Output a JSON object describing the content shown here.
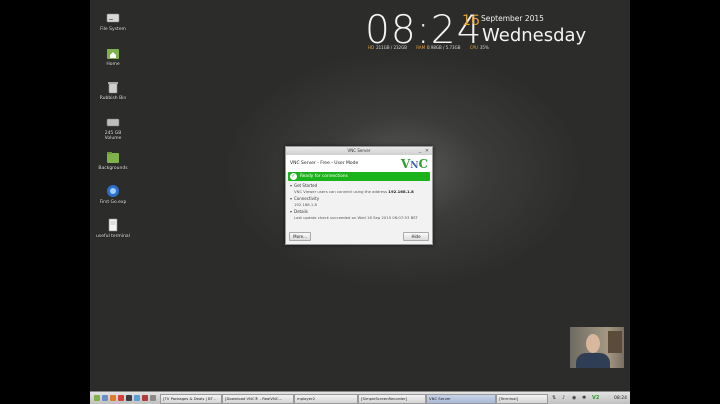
{
  "desktop": {
    "icons": [
      {
        "label": "File System",
        "icon": "drive-icon"
      },
      {
        "label": "Home",
        "icon": "home-folder-icon"
      },
      {
        "label": "Rubbish Bin",
        "icon": "trash-icon"
      },
      {
        "label": "245 GB\nVolume",
        "icon": "drive-icon"
      },
      {
        "label": "Backgrounds",
        "icon": "folder-icon"
      },
      {
        "label": "First Go.exp",
        "icon": "app-icon"
      },
      {
        "label": "useful terminal",
        "icon": "text-file-icon"
      }
    ]
  },
  "clock": {
    "time": "08:24",
    "day": "16",
    "month_year": "September 2015",
    "weekday": "Wednesday",
    "hd_label": "HD",
    "hd_value": "211GB / 232GB",
    "ram_label": "RAM",
    "ram_value": "0.98GB / 5.73GB",
    "cpu_label": "CPU",
    "cpu_value": "35%",
    "accent_color": "#e8a23a"
  },
  "vnc_window": {
    "title": "VNC Server",
    "mode": "VNC Server - Free - User Mode",
    "status": "Ready for connections",
    "sections": [
      {
        "title": "Get Started",
        "body_prefix": "VNC Viewer users can connect using the address",
        "body_value": "192.168.1.8"
      },
      {
        "title": "Connectivity",
        "body_prefix": "192.168.1.8",
        "body_value": ""
      },
      {
        "title": "Details",
        "body_prefix": "Last update check succeeded on Wed 16 Sep 2015 08:07:53 BST",
        "body_value": ""
      }
    ],
    "more_button": "More...",
    "hide_button": "Hide",
    "status_color": "#1bb31b"
  },
  "taskbar": {
    "tasks": [
      {
        "label": "[TV Packages & Deals | BT -",
        "active": false
      },
      {
        "label": "[Download VNC® - RealVNC...",
        "active": false
      },
      {
        "label": "mplayer2",
        "active": false
      },
      {
        "label": "[SimpleScreenRecorder]",
        "active": false
      },
      {
        "label": "VNC Server",
        "active": true
      },
      {
        "label": "[Terminal]",
        "active": false
      }
    ],
    "clock": "08:24"
  }
}
